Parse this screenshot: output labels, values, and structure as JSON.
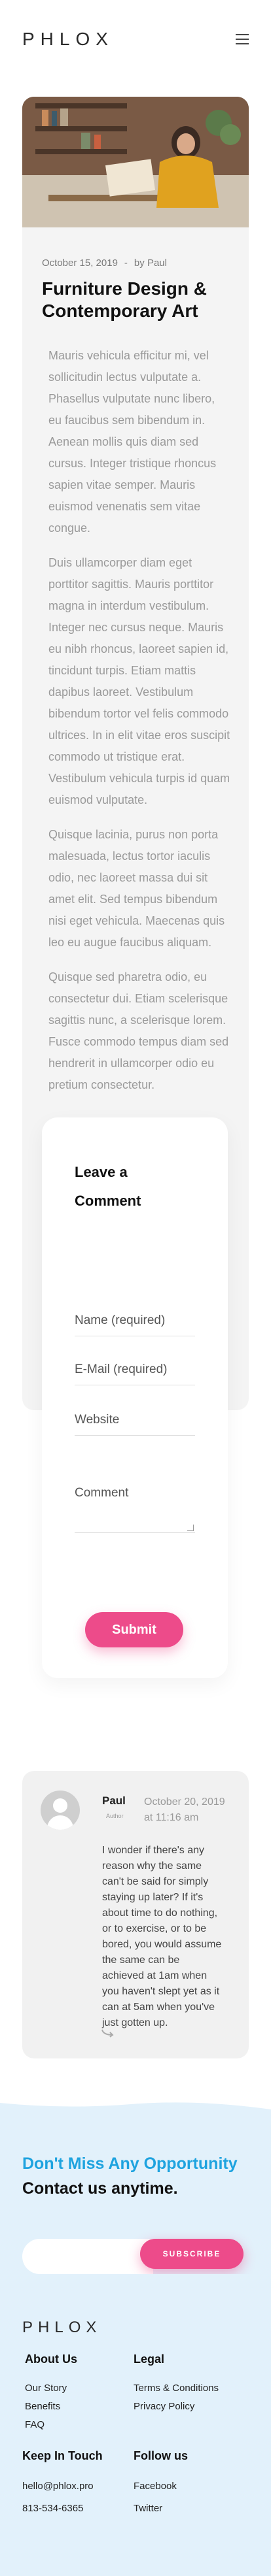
{
  "header": {
    "logo": "PHLOX"
  },
  "post": {
    "date": "October 15, 2019",
    "separator": "-",
    "author_prefix": "by",
    "author": "Paul",
    "title": "Furniture Design & Contemporary Art",
    "paragraphs": [
      "Mauris vehicula efficitur mi, vel sollicitudin lectus vulputate a. Phasellus vulputate nunc libero, eu faucibus sem bibendum in. Aenean mollis quis diam sed cursus. Integer tristique rhoncus sapien vitae semper. Mauris euismod venenatis sem vitae congue.",
      "Duis ullamcorper diam eget porttitor sagittis. Mauris porttitor magna in interdum vestibulum. Integer nec cursus neque. Mauris eu nibh rhoncus, laoreet sapien id, tincidunt turpis. Etiam mattis dapibus laoreet. Vestibulum bibendum tortor vel felis commodo ultrices. In in elit vitae eros suscipit commodo ut tristique erat. Vestibulum vehicula turpis id quam euismod vulputate.",
      "Quisque lacinia, purus non porta malesuada, lectus tortor iaculis odio, nec laoreet massa dui sit amet elit. Sed tempus bibendum nisi eget vehicula. Maecenas quis leo eu augue faucibus aliquam.",
      "Quisque sed pharetra odio, eu consectetur dui. Etiam scelerisque sagittis nunc, a scelerisque lorem. Fusce commodo tempus diam sed hendrerit in ullamcorper odio eu pretium consectetur."
    ]
  },
  "comment_form": {
    "title": "Leave a Comment",
    "name_placeholder": "Name (required)",
    "email_placeholder": "E-Mail (required)",
    "website_placeholder": "Website",
    "comment_placeholder": "Comment",
    "submit_label": "Submit"
  },
  "comment": {
    "author": "Paul",
    "role": "Author",
    "date": "October 20, 2019 at 11:16 am",
    "text": "I wonder if there's any reason why the same can't be said for simply staying up later? If it's about time to do nothing, or to exercise, or to be bored, you would assume the same can be achieved at 1am when you haven't slept yet as it can at 5am when you've just gotten up."
  },
  "newsletter": {
    "accent_text": "Don't Miss Any Opportunity",
    "rest_text": " Contact us anytime.",
    "input_placeholder": "",
    "button_label": "SUBSCRIBE"
  },
  "footer": {
    "logo": "PHLOX",
    "about_title": "About Us",
    "about_links": [
      "Our Story",
      "Benefits",
      "FAQ"
    ],
    "legal_title": "Legal",
    "legal_links": [
      "Terms & Conditions",
      "Privacy Policy"
    ],
    "keep_title": "Keep In Touch",
    "keep_links": [
      "hello@phlox.pro",
      "813-534-6365"
    ],
    "follow_title": "Follow us",
    "follow_links": [
      "Facebook",
      "Twitter"
    ]
  },
  "colors": {
    "accent_pink": "#ed4b8a",
    "accent_blue": "#1ea3df",
    "footer_bg": "#e2f1fb"
  }
}
